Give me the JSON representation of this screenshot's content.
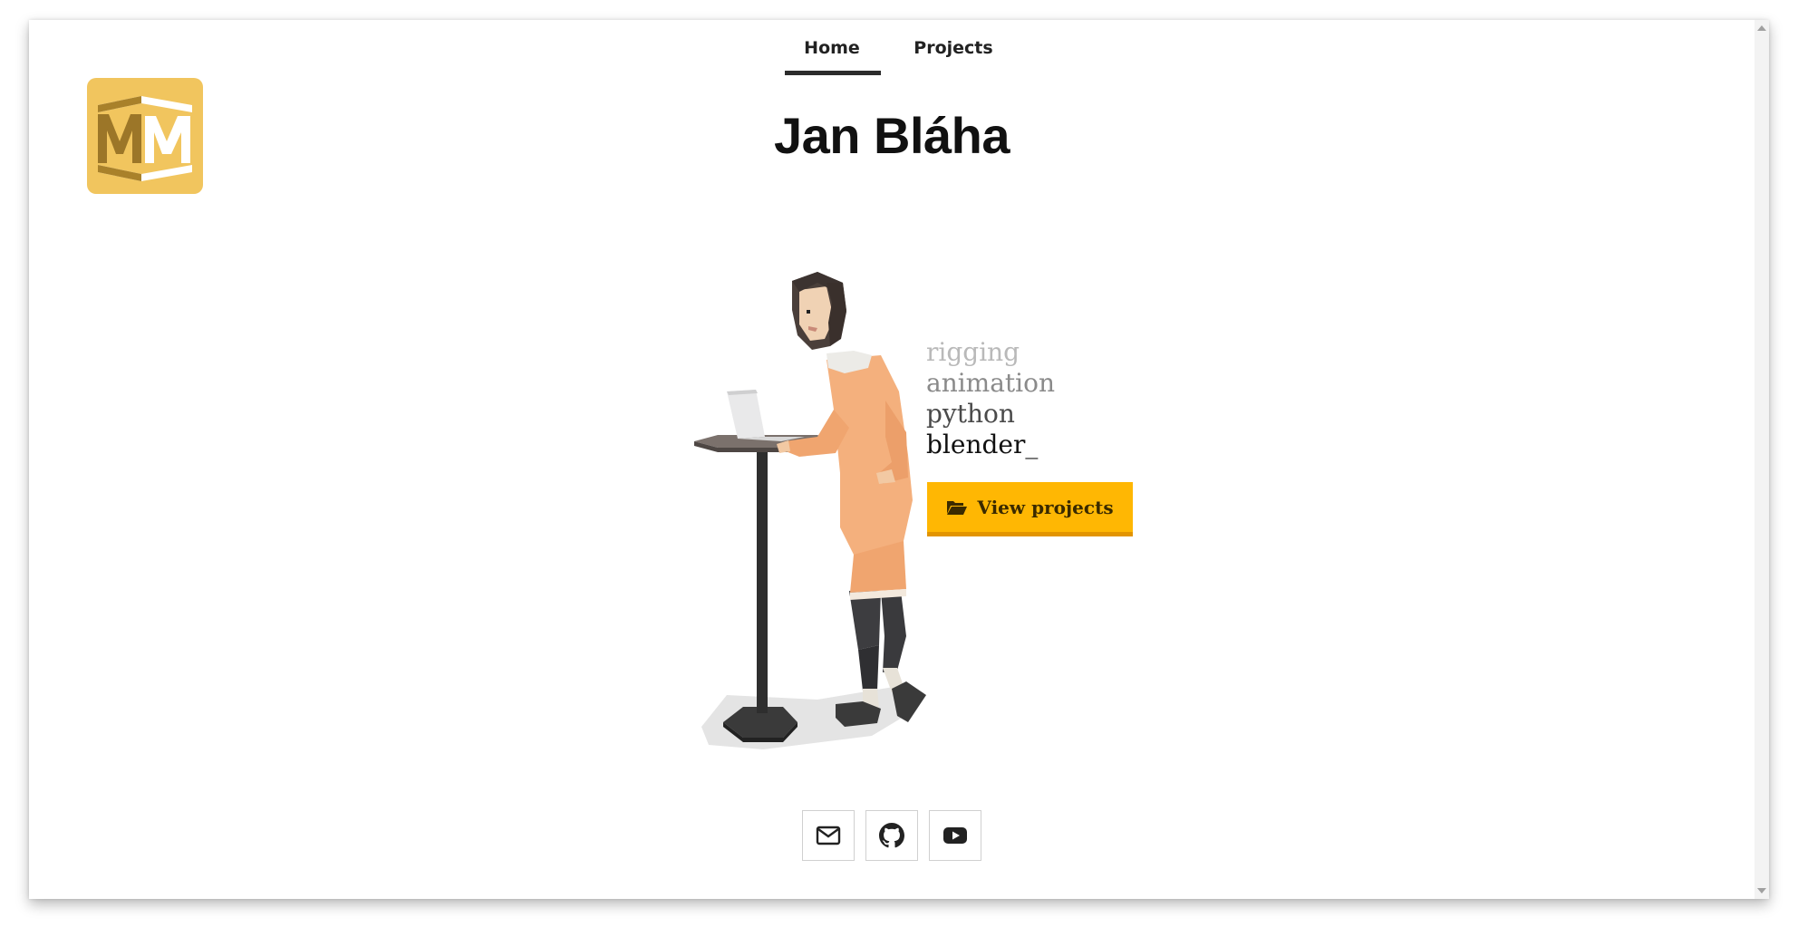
{
  "nav": {
    "items": [
      {
        "label": "Home",
        "active": true
      },
      {
        "label": "Projects",
        "active": false
      }
    ]
  },
  "logo": {
    "text": "MM",
    "color": "#f1c55e"
  },
  "title": "Jan Bláha",
  "skills": [
    "rigging",
    "animation",
    "python",
    "blender_"
  ],
  "cta": {
    "label": "View projects",
    "icon": "folder-open-icon",
    "color": "#ffb703"
  },
  "social": [
    {
      "name": "email",
      "icon": "envelope-icon"
    },
    {
      "name": "github",
      "icon": "github-icon"
    },
    {
      "name": "youtube",
      "icon": "youtube-icon"
    }
  ]
}
